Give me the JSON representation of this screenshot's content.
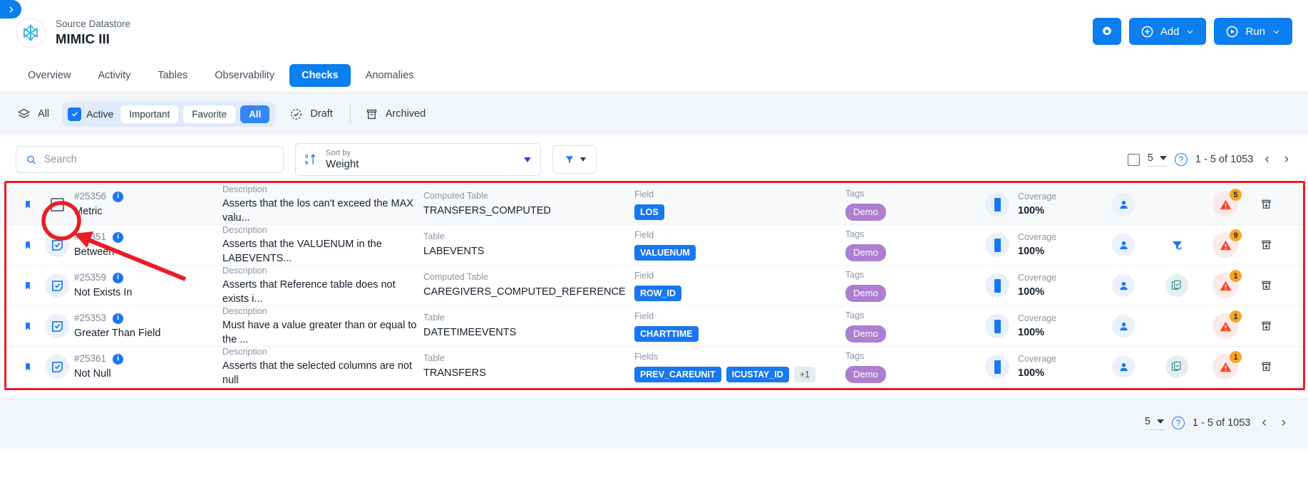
{
  "header": {
    "expand_icon": "chevron-right-icon",
    "logo_icon": "snowflake-icon",
    "subtitle": "Source Datastore",
    "title": "MIMIC III",
    "settings_icon": "gear-icon",
    "add_label": "Add",
    "add_icon": "plus-circle-icon",
    "run_label": "Run",
    "run_icon": "play-circle-icon"
  },
  "tabs": [
    {
      "label": "Overview",
      "active": false
    },
    {
      "label": "Activity",
      "active": false
    },
    {
      "label": "Tables",
      "active": false
    },
    {
      "label": "Observability",
      "active": false
    },
    {
      "label": "Checks",
      "active": true
    },
    {
      "label": "Anomalies",
      "active": false
    }
  ],
  "filterbar": {
    "all_label": "All",
    "all_icon": "layers-icon",
    "active_label": "Active",
    "segments": [
      {
        "label": "Important",
        "selected": false
      },
      {
        "label": "Favorite",
        "selected": false
      },
      {
        "label": "All",
        "selected": true
      }
    ],
    "draft_label": "Draft",
    "draft_icon": "draft-circle-icon",
    "archived_label": "Archived",
    "archived_icon": "archive-icon"
  },
  "search": {
    "placeholder": "Search",
    "icon": "search-icon",
    "sort_key": "Sort by",
    "sort_value": "Weight",
    "sort_icon": "sort-ascending-icon",
    "filter_icon": "funnel-icon"
  },
  "pagination": {
    "page_size": "5",
    "range": "1 - 5 of 1053",
    "help_icon": "help-circle-icon",
    "prev_icon": "chevron-left-icon",
    "next_icon": "chevron-right-icon"
  },
  "columns": {
    "description": "Description",
    "table": "Table",
    "computed_table": "Computed Table",
    "field": "Field",
    "fields": "Fields",
    "tags": "Tags",
    "coverage": "Coverage"
  },
  "rows": [
    {
      "id": "#25356",
      "name": "Metric",
      "description": "Asserts that the los can't exceed the MAX valu...",
      "table_key": "Computed Table",
      "table_value": "TRANSFERS_COMPUTED",
      "field_key": "Field",
      "fields": [
        "LOS"
      ],
      "more_fields": null,
      "tags": [
        "Demo"
      ],
      "coverage": "100%",
      "alert_count": "5",
      "status_icon": "empty-checkbox-icon",
      "extra_icon": null,
      "highlighted": true
    },
    {
      "id": "#25351",
      "name": "Between",
      "description": "Asserts that the VALUENUM in the LABEVENTS...",
      "table_key": "Table",
      "table_value": "LABEVENTS",
      "field_key": "Field",
      "fields": [
        "VALUENUM"
      ],
      "more_fields": null,
      "tags": [
        "Demo"
      ],
      "coverage": "100%",
      "alert_count": "9",
      "status_icon": "checked-document-icon",
      "extra_icon": "funnel-check-icon",
      "highlighted": false
    },
    {
      "id": "#25359",
      "name": "Not Exists In",
      "description": "Asserts that Reference table does not exists i...",
      "table_key": "Computed Table",
      "table_value": "CAREGIVERS_COMPUTED_REFERENCE",
      "field_key": "Field",
      "fields": [
        "ROW_ID"
      ],
      "more_fields": null,
      "tags": [
        "Demo"
      ],
      "coverage": "100%",
      "alert_count": "1",
      "status_icon": "checked-document-icon",
      "extra_icon": "clipboard-check-icon",
      "highlighted": false
    },
    {
      "id": "#25353",
      "name": "Greater Than Field",
      "description": "Must have a value greater than or equal to the ...",
      "table_key": "Table",
      "table_value": "DATETIMEEVENTS",
      "field_key": "Field",
      "fields": [
        "CHARTTIME"
      ],
      "more_fields": null,
      "tags": [
        "Demo"
      ],
      "coverage": "100%",
      "alert_count": "1",
      "status_icon": "checked-document-icon",
      "extra_icon": null,
      "highlighted": false
    },
    {
      "id": "#25361",
      "name": "Not Null",
      "description": "Asserts that the selected columns are not null",
      "table_key": "Table",
      "table_value": "TRANSFERS",
      "field_key": "Fields",
      "fields": [
        "PREV_CAREUNIT",
        "ICUSTAY_ID"
      ],
      "more_fields": "+1",
      "tags": [
        "Demo"
      ],
      "coverage": "100%",
      "alert_count": "1",
      "status_icon": "checked-document-icon",
      "extra_icon": "clipboard-check-icon",
      "highlighted": false
    }
  ],
  "colors": {
    "primary": "#0b7ef0",
    "badge_blue": "#1877f2",
    "tag_purple": "#ae7ed0",
    "alert_red": "#f4472e",
    "alert_badge": "#f5a623",
    "annotation_red": "#ec1c24"
  }
}
